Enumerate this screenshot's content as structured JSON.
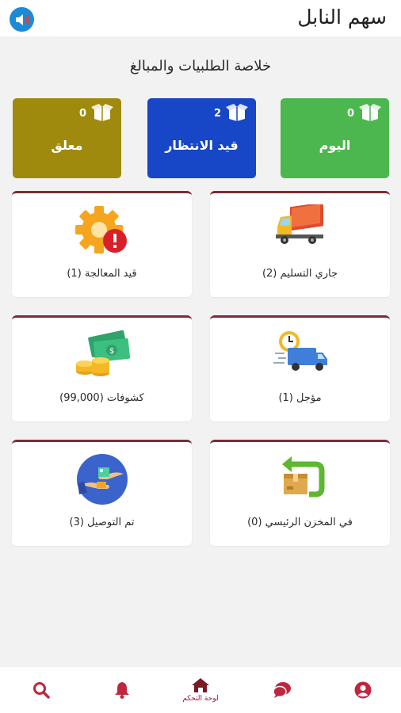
{
  "header": {
    "title": "سهم النابل",
    "volume_icon": "volume-icon"
  },
  "summary": {
    "title": "خلاصة الطلبيات والمبالغ"
  },
  "stats": [
    {
      "label": "اليوم",
      "count": "0",
      "color": "#4cb74f",
      "icon": "box-icon"
    },
    {
      "label": "قيد الانتظار",
      "count": "2",
      "color": "#1746c6",
      "icon": "box-icon"
    },
    {
      "label": "معلق",
      "count": "0",
      "color": "#a08a0d",
      "icon": "box-icon"
    }
  ],
  "tiles": [
    {
      "label": "جاري التسليم (2)",
      "icon": "delivery-truck-icon"
    },
    {
      "label": "قيد المعالجة (1)",
      "icon": "gear-warning-icon"
    },
    {
      "label": "مؤجل (1)",
      "icon": "delayed-truck-icon"
    },
    {
      "label": "كشوفات (99,000)",
      "icon": "money-coins-icon"
    },
    {
      "label": "في المخزن الرئيسي (0)",
      "icon": "return-box-icon"
    },
    {
      "label": "تم التوصيل (3)",
      "icon": "hand-delivery-icon"
    }
  ],
  "nav": {
    "dashboard_label": "لوحة التحكم",
    "accent": "#c0263f"
  }
}
